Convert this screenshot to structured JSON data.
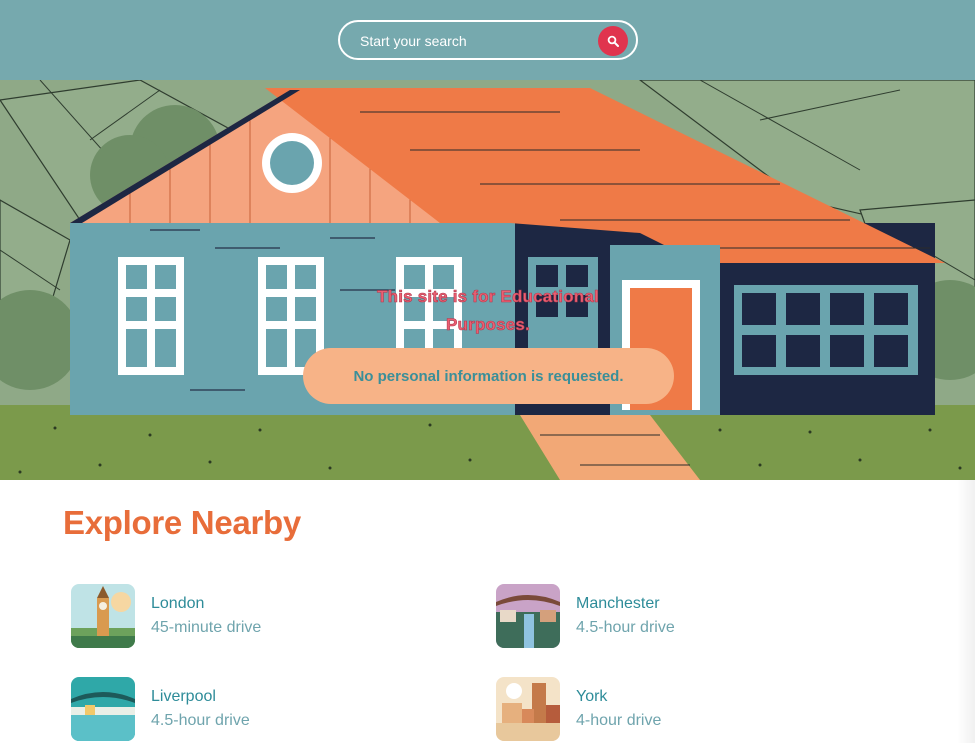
{
  "search": {
    "placeholder": "Start your search",
    "icon": "search-icon"
  },
  "hero": {
    "title": "This site is for Educational Purposes.",
    "button_label": "No personal information is requested."
  },
  "explore": {
    "title": "Explore Nearby",
    "places": [
      {
        "name": "London",
        "distance": "45-minute drive"
      },
      {
        "name": "Manchester",
        "distance": "4.5-hour drive"
      },
      {
        "name": "Liverpool",
        "distance": "4.5-hour drive"
      },
      {
        "name": "York",
        "distance": "4-hour drive"
      }
    ]
  },
  "colors": {
    "header": "#76a9ae",
    "search_button": "#e0344e",
    "accent": "#e86d3a",
    "link": "#2e8c99",
    "hero_button": "#f7b387"
  }
}
